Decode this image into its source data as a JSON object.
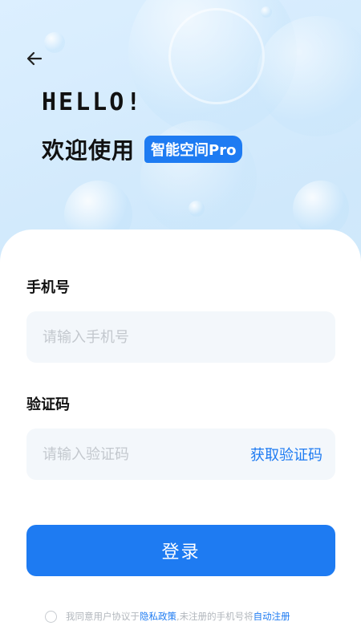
{
  "header": {
    "hello": "HELLO!",
    "welcome": "欢迎使用",
    "app_badge": "智能空间Pro"
  },
  "form": {
    "phone_label": "手机号",
    "phone_placeholder": "请输入手机号",
    "code_label": "验证码",
    "code_placeholder": "请输入验证码",
    "get_code_label": "获取验证码",
    "login_label": "登录"
  },
  "agreement": {
    "prefix": "我同意用户协议于",
    "privacy_link": "隐私政策",
    "middle": ",未注册的手机号将",
    "auto_register_link": "自动注册"
  },
  "colors": {
    "accent": "#1e7bf2",
    "placeholder": "#c3c8ce",
    "field_bg": "#f3f7fb"
  }
}
